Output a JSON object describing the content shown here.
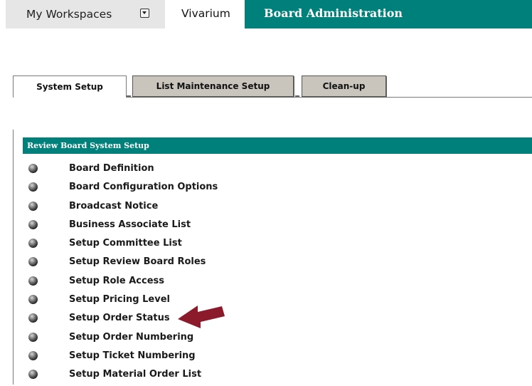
{
  "top_nav": {
    "workspaces_label": "My Workspaces",
    "site_label": "Vivarium",
    "tool_label": "Board Administration"
  },
  "tabs": [
    {
      "label": "System Setup",
      "active": true
    },
    {
      "label": "List Maintenance Setup",
      "active": false
    },
    {
      "label": "Clean-up",
      "active": false
    }
  ],
  "panel": {
    "title": "Review Board System Setup",
    "items": [
      "Board Definition",
      "Board Configuration Options",
      "Broadcast Notice",
      "Business Associate List",
      "Setup Committee List",
      "Setup Review Board Roles",
      "Setup Role Access",
      "Setup Pricing Level",
      "Setup Order Status",
      "Setup Order Numbering",
      "Setup Ticket Numbering",
      "Setup Material Order List"
    ]
  },
  "colors": {
    "accent_teal": "#00807a",
    "tab_inactive": "#c9c5bd",
    "arrow": "#8b1a2b"
  },
  "icons": {
    "workspaces_dropdown": "chevron-down-icon",
    "list_bullet": "bullet-icon",
    "annotation": "arrow-icon"
  }
}
